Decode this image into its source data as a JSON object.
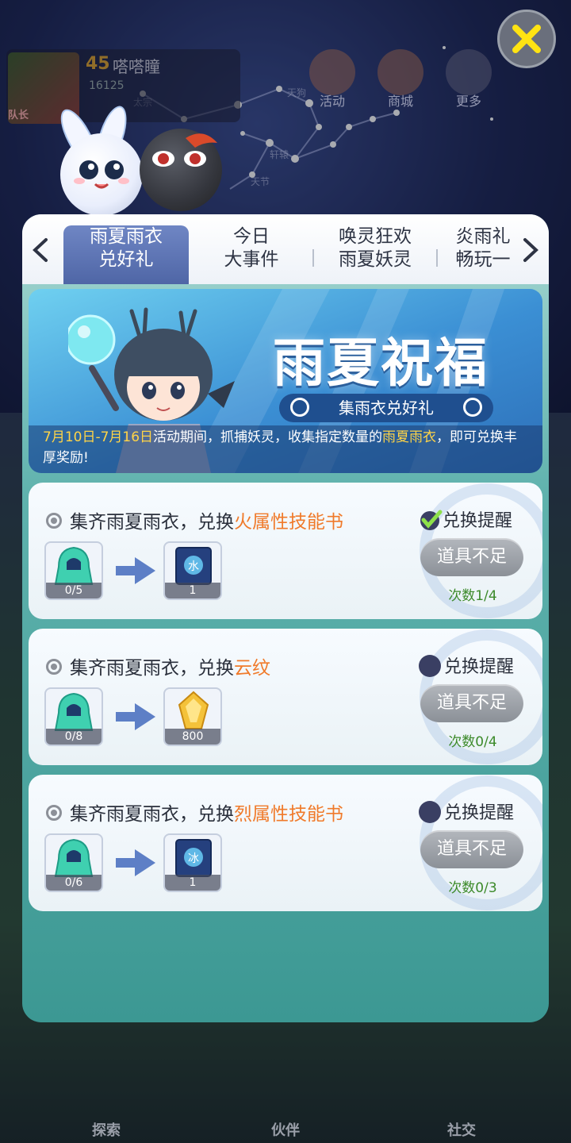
{
  "background": {
    "player": {
      "level": "45",
      "name": "嗒嗒瞳",
      "id": "16125",
      "tag": "队长"
    },
    "top_icons": [
      {
        "label": "活动",
        "icon": "gift-icon"
      },
      {
        "label": "商城",
        "icon": "shop-icon"
      },
      {
        "label": "更多",
        "icon": "grid-icon"
      }
    ],
    "constellation_labels": [
      "天狗",
      "轩辕",
      "天节",
      "太宗"
    ],
    "bottom_nav": [
      "探索",
      "伙伴",
      "社交"
    ]
  },
  "tabs": [
    {
      "line1": "雨夏雨衣",
      "line2": "兑好礼",
      "active": true
    },
    {
      "line1": "今日",
      "line2": "大事件",
      "active": false
    },
    {
      "line1": "唤灵狂欢",
      "line2": "雨夏妖灵",
      "active": false
    },
    {
      "line1": "炎雨礼",
      "line2": "畅玩一",
      "active": false
    }
  ],
  "banner": {
    "title": "雨夏祝福",
    "subtitle": "集雨衣兑好礼",
    "desc_date": "7月10日-7月16日",
    "desc_mid": "活动期间，抓捕妖灵，收集指定数量的",
    "desc_item": "雨夏雨衣",
    "desc_end": "，即可兑换丰厚奖励!"
  },
  "cards": [
    {
      "title_prefix": "集齐雨夏雨衣，兑换",
      "reward_name": "火属性技能书",
      "cost_count": "0/5",
      "reward_count": "1",
      "reward_icon": "skill-book-icon",
      "reward_glyph": "水",
      "remind_label": "兑换提醒",
      "remind_on": true,
      "button_label": "道具不足",
      "times": "次数1/4"
    },
    {
      "title_prefix": "集齐雨夏雨衣，兑换",
      "reward_name": "云纹",
      "cost_count": "0/8",
      "reward_count": "800",
      "reward_icon": "cloud-pattern-icon",
      "reward_glyph": "",
      "remind_label": "兑换提醒",
      "remind_on": false,
      "button_label": "道具不足",
      "times": "次数0/4"
    },
    {
      "title_prefix": "集齐雨夏雨衣，兑换",
      "reward_name": "烈属性技能书",
      "cost_count": "0/6",
      "reward_count": "1",
      "reward_icon": "skill-book-icon",
      "reward_glyph": "冰",
      "remind_label": "兑换提醒",
      "remind_on": false,
      "button_label": "道具不足",
      "times": "次数0/3"
    }
  ],
  "colors": {
    "accent_orange": "#f07a2a",
    "highlight_yellow": "#ffd447",
    "times_green": "#3c8a2a",
    "active_tab": "#5a71b3"
  }
}
